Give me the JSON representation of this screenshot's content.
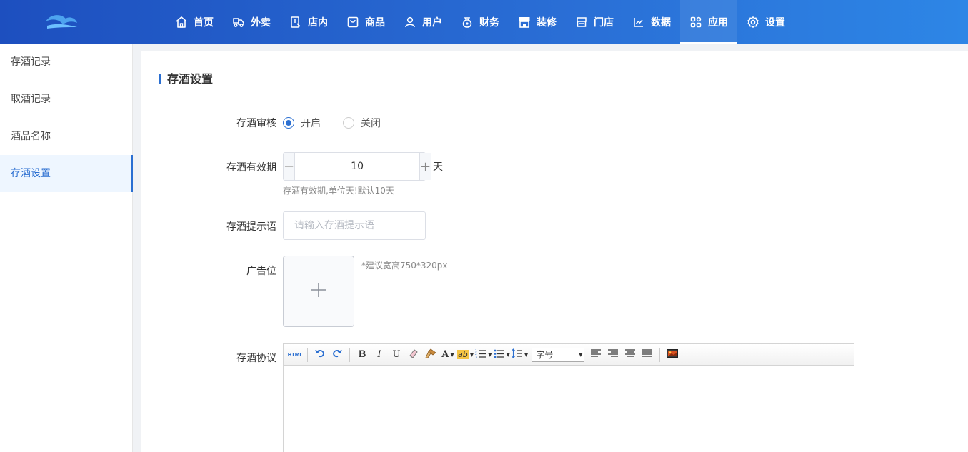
{
  "nav": {
    "items": [
      {
        "label": "首页",
        "icon": "home-icon"
      },
      {
        "label": "外卖",
        "icon": "delivery-icon"
      },
      {
        "label": "店内",
        "icon": "dine-in-icon"
      },
      {
        "label": "商品",
        "icon": "product-icon"
      },
      {
        "label": "用户",
        "icon": "user-icon"
      },
      {
        "label": "财务",
        "icon": "finance-icon"
      },
      {
        "label": "装修",
        "icon": "decoration-icon"
      },
      {
        "label": "门店",
        "icon": "store-icon"
      },
      {
        "label": "数据",
        "icon": "data-chart-icon"
      },
      {
        "label": "应用",
        "icon": "apps-icon"
      },
      {
        "label": "设置",
        "icon": "settings-gear-icon"
      }
    ],
    "active_index": 9
  },
  "sidebar": {
    "items": [
      {
        "label": "存酒记录"
      },
      {
        "label": "取酒记录"
      },
      {
        "label": "酒品名称"
      },
      {
        "label": "存酒设置"
      }
    ],
    "active_index": 3
  },
  "main": {
    "title": "存酒设置",
    "review": {
      "label": "存酒审核",
      "options": [
        "开启",
        "关闭"
      ],
      "selected": "开启"
    },
    "validity": {
      "label": "存酒有效期",
      "value": "10",
      "unit": "天",
      "minus": "−",
      "plus": "+",
      "hint": "存酒有效期,单位天!默认10天"
    },
    "prompt": {
      "label": "存酒提示语",
      "placeholder": "请输入存酒提示语",
      "value": ""
    },
    "ad": {
      "label": "广告位",
      "hint": "*建议宽高750*320px"
    },
    "agreement": {
      "label": "存酒协议",
      "toolbar": {
        "html": "HTML",
        "bold": "B",
        "italic": "I",
        "underline": "U",
        "font_color": "A",
        "highlight": "ab",
        "font_size": "字号"
      }
    }
  },
  "colors": {
    "accent": "#2b6fd1",
    "nav_start": "#1d4fbf",
    "nav_end": "#2d86e6"
  }
}
